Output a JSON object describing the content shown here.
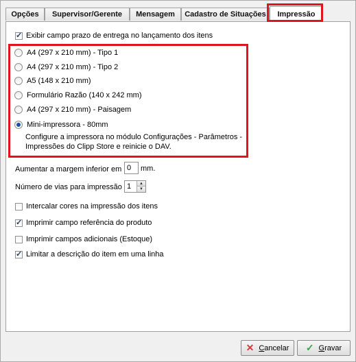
{
  "tabs": [
    {
      "label": "Opções"
    },
    {
      "label": "Supervisor/Gerente"
    },
    {
      "label": "Mensagem"
    },
    {
      "label": "Cadastro de Situações"
    },
    {
      "label": "Impressão",
      "active": true
    }
  ],
  "impressao": {
    "exibir_prazo": {
      "label": "Exibir campo prazo de entrega no lançamento dos itens",
      "checked": true
    },
    "paper_options": [
      {
        "label": "A4 (297 x 210 mm) - Tipo 1",
        "selected": false
      },
      {
        "label": "A4 (297 x 210 mm) - Tipo 2",
        "selected": false
      },
      {
        "label": "A5 (148 x 210 mm)",
        "selected": false
      },
      {
        "label": "Formulário Razão (140 x 242 mm)",
        "selected": false
      },
      {
        "label": "A4 (297 x 210 mm) - Paisagem",
        "selected": false
      },
      {
        "label": "Mini-impressora - 80mm",
        "selected": true
      }
    ],
    "mini_description": "Configure a impressora no módulo Configurações - Parâmetros - Impressões do Clipp Store e reinicie o DAV.",
    "margin": {
      "label": "Aumentar a margem inferior em",
      "value": "0",
      "unit": "mm."
    },
    "vias": {
      "label": "Número de vias para impressão",
      "value": "1"
    },
    "checkboxes": [
      {
        "label": "Intercalar cores na impressão dos itens",
        "checked": false
      },
      {
        "label": "Imprimir campo referência do produto",
        "checked": true
      },
      {
        "label": "Imprimir campos adicionais (Estoque)",
        "checked": false
      },
      {
        "label": "Limitar a descrição do item em uma linha",
        "checked": true
      }
    ]
  },
  "buttons": {
    "cancel": {
      "label_u": "C",
      "label_rest": "ancelar"
    },
    "save": {
      "label_u": "G",
      "label_rest": "ravar"
    }
  },
  "colors": {
    "highlight": "#e0141e",
    "cancel_icon": "#d9363e",
    "save_icon": "#3aa24a"
  }
}
